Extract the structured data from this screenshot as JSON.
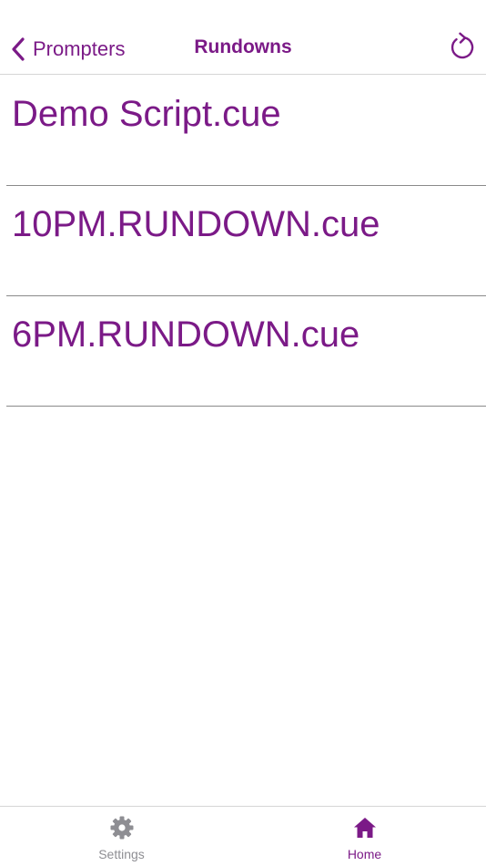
{
  "colors": {
    "accent": "#7b1a87",
    "inactive": "#8e8e93",
    "separator": "#8a8a8a"
  },
  "navbar": {
    "back_label": "Prompters",
    "title": "Rundowns",
    "back_icon": "chevron-left-icon",
    "refresh_icon": "refresh-icon"
  },
  "rundowns": {
    "items": [
      {
        "label": "Demo Script.cue"
      },
      {
        "label": "10PM.RUNDOWN.cue"
      },
      {
        "label": "6PM.RUNDOWN.cue"
      }
    ]
  },
  "tabbar": {
    "tabs": [
      {
        "label": "Settings",
        "icon": "gear-icon",
        "active": false
      },
      {
        "label": "Home",
        "icon": "home-icon",
        "active": true
      }
    ]
  }
}
